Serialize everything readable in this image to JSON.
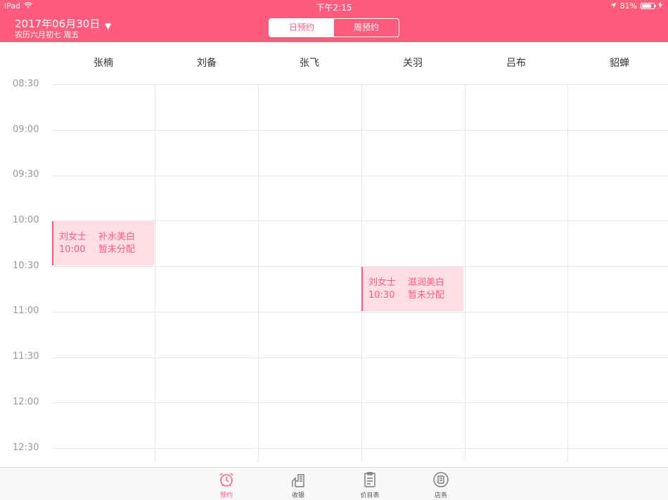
{
  "status_bar": {
    "device": "iPad",
    "time": "下午2:15",
    "battery": "81%",
    "battery_level": 0.81
  },
  "header": {
    "date": "2017年06月30日",
    "lunar": "农历六月初七 周五",
    "dropdown_glyph": "▼",
    "view_tabs": [
      {
        "label": "日预约",
        "active": true
      },
      {
        "label": "周预约",
        "active": false
      }
    ]
  },
  "staff": [
    "张楠",
    "刘备",
    "张飞",
    "关羽",
    "吕布",
    "貂蝉"
  ],
  "time_slots": [
    "08:30",
    "09:00",
    "09:30",
    "10:00",
    "10:30",
    "11:00",
    "11:30",
    "12:00",
    "12:30"
  ],
  "appointments": [
    {
      "customer": "刘女士",
      "service": "补水美白",
      "time": "10:00",
      "assignee": "暂未分配"
    },
    {
      "customer": "刘女士",
      "service": "滋润美白",
      "time": "10:30",
      "assignee": "暂未分配"
    }
  ],
  "tab_bar": [
    {
      "label": "预约",
      "icon": "alarm-clock-icon",
      "active": true
    },
    {
      "label": "收银",
      "icon": "cash-register-icon",
      "active": false
    },
    {
      "label": "价目表",
      "icon": "price-list-icon",
      "active": false
    },
    {
      "label": "店务",
      "icon": "store-affairs-icon",
      "active": false
    }
  ],
  "colors": {
    "accent": "#fe5c7c",
    "appointment_bg": "#ffdfe5",
    "grid_line": "#e6e6e6"
  }
}
